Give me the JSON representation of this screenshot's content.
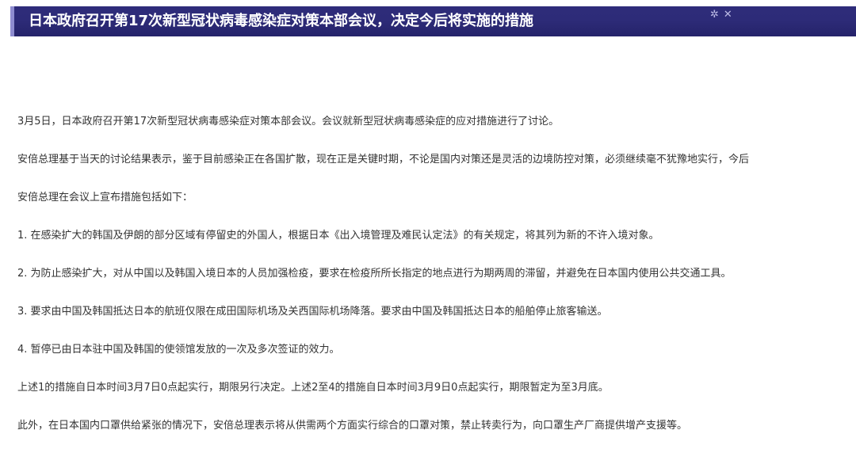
{
  "header": {
    "title": "日本政府召开第17次新型冠状病毒感染症对策本部会议，决定今后将实施的措施",
    "settings_icon": "✲",
    "close_icon": "✕"
  },
  "article": {
    "paragraphs": [
      "3月5日，日本政府召开第17次新型冠状病毒感染症对策本部会议。会议就新型冠状病毒感染症的应对措施进行了讨论。",
      "安倍总理基于当天的讨论结果表示，鉴于目前感染正在各国扩散，现在正是关键时期，不论是国内对策还是灵活的边境防控对策，必须继续毫不犹豫地实行，今后",
      "安倍总理在会议上宣布措施包括如下：",
      "1. 在感染扩大的韩国及伊朗的部分区域有停留史的外国人，根据日本《出入境管理及难民认定法》的有关规定，将其列为新的不许入境对象。",
      "2. 为防止感染扩大，对从中国以及韩国入境日本的人员加强检疫，要求在检疫所所长指定的地点进行为期两周的滞留，并避免在日本国内使用公共交通工具。",
      "3. 要求由中国及韩国抵达日本的航班仅限在成田国际机场及关西国际机场降落。要求由中国及韩国抵达日本的船舶停止旅客输送。",
      "4. 暂停已由日本驻中国及韩国的使领馆发放的一次及多次签证的效力。",
      "上述1的措施自日本时间3月7日0点起实行，期限另行决定。上述2至4的措施自日本时间3月9日0点起实行，期限暂定为至3月底。",
      "此外，在日本国内口罩供给紧张的情况下，安倍总理表示将从供需两个方面实行综合的口罩对策，禁止转卖行为，向口罩生产厂商提供增产支援等。"
    ]
  }
}
